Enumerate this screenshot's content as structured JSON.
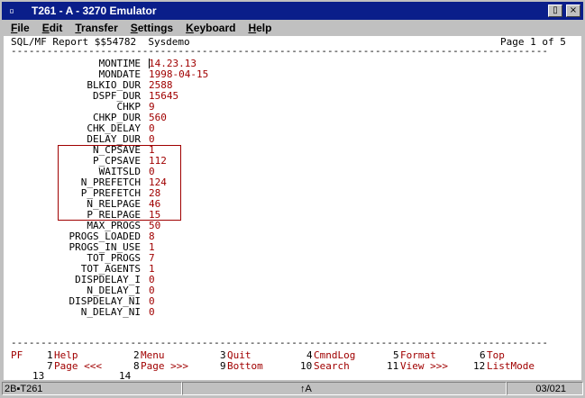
{
  "window": {
    "icon_label": "▫",
    "title": "T261 - A - 3270 Emulator",
    "btn_restore": "▯",
    "btn_close": "×"
  },
  "menu": [
    {
      "label": "File",
      "key": "F",
      "rest": "ile"
    },
    {
      "label": "Edit",
      "key": "E",
      "rest": "dit"
    },
    {
      "label": "Transfer",
      "key": "T",
      "rest": "ransfer"
    },
    {
      "label": "Settings",
      "key": "S",
      "rest": "ettings"
    },
    {
      "label": "Keyboard",
      "key": "K",
      "rest": "eyboard"
    },
    {
      "label": "Help",
      "key": "H",
      "rest": "elp"
    }
  ],
  "header": {
    "report": "SQL/MF Report $$54782  Sysdemo",
    "page": "Page 1 of 5"
  },
  "separator": "------------------------------------------------------------------------------------------",
  "fields": [
    {
      "label": "MONTIME",
      "value": "14.23.13"
    },
    {
      "label": "MONDATE",
      "value": "1998-04-15"
    },
    {
      "label": "BLKIO_DUR",
      "value": "2588"
    },
    {
      "label": "DSPF_DUR",
      "value": "15645"
    },
    {
      "label": "CHKP",
      "value": "9"
    },
    {
      "label": "CHKP_DUR",
      "value": "560"
    },
    {
      "label": "CHK_DELAY",
      "value": "0"
    },
    {
      "label": "DELAY_DUR",
      "value": "0"
    },
    {
      "label": "N_CPSAVE",
      "value": "1"
    },
    {
      "label": "P_CPSAVE",
      "value": "112"
    },
    {
      "label": "WAITSLD",
      "value": "0"
    },
    {
      "label": "N_PREFETCH",
      "value": "124"
    },
    {
      "label": "P_PREFETCH",
      "value": "28"
    },
    {
      "label": "N_RELPAGE",
      "value": "46"
    },
    {
      "label": "P_RELPAGE",
      "value": "15"
    },
    {
      "label": "MAX_PROGS",
      "value": "50"
    },
    {
      "label": "PROGS_LOADED",
      "value": "8"
    },
    {
      "label": "PROGS_IN_USE",
      "value": "1"
    },
    {
      "label": "TOT_PROGS",
      "value": "7"
    },
    {
      "label": "TOT_AGENTS",
      "value": "1"
    },
    {
      "label": "DISPDELAY_I",
      "value": "0"
    },
    {
      "label": "N_DELAY_I",
      "value": "0"
    },
    {
      "label": "DISPDELAY_NI",
      "value": "0"
    },
    {
      "label": "N_DELAY_NI",
      "value": "0"
    }
  ],
  "pf": {
    "prefix": "PF",
    "row1": [
      {
        "num": "1",
        "label": "Help"
      },
      {
        "num": "2",
        "label": "Menu"
      },
      {
        "num": "3",
        "label": "Quit"
      },
      {
        "num": "4",
        "label": "CmndLog"
      },
      {
        "num": "5",
        "label": "Format"
      },
      {
        "num": "6",
        "label": "Top"
      }
    ],
    "row2": [
      {
        "num": "7",
        "label": "Page <<<"
      },
      {
        "num": "8",
        "label": "Page >>>"
      },
      {
        "num": "9",
        "label": "Bottom"
      },
      {
        "num": "10",
        "label": "Search"
      },
      {
        "num": "11",
        "label": "View >>>"
      },
      {
        "num": "12",
        "label": "ListMode"
      }
    ],
    "row3": [
      {
        "num": "13",
        "label": ""
      },
      {
        "num": "14",
        "label": ""
      }
    ]
  },
  "status": {
    "session": "2B▪T261",
    "indicator": "↑A",
    "position": "03/021"
  },
  "colors": {
    "titlebar": "#0a1e8a",
    "value_text": "#a00000",
    "terminal_bg": "#ffffff"
  }
}
